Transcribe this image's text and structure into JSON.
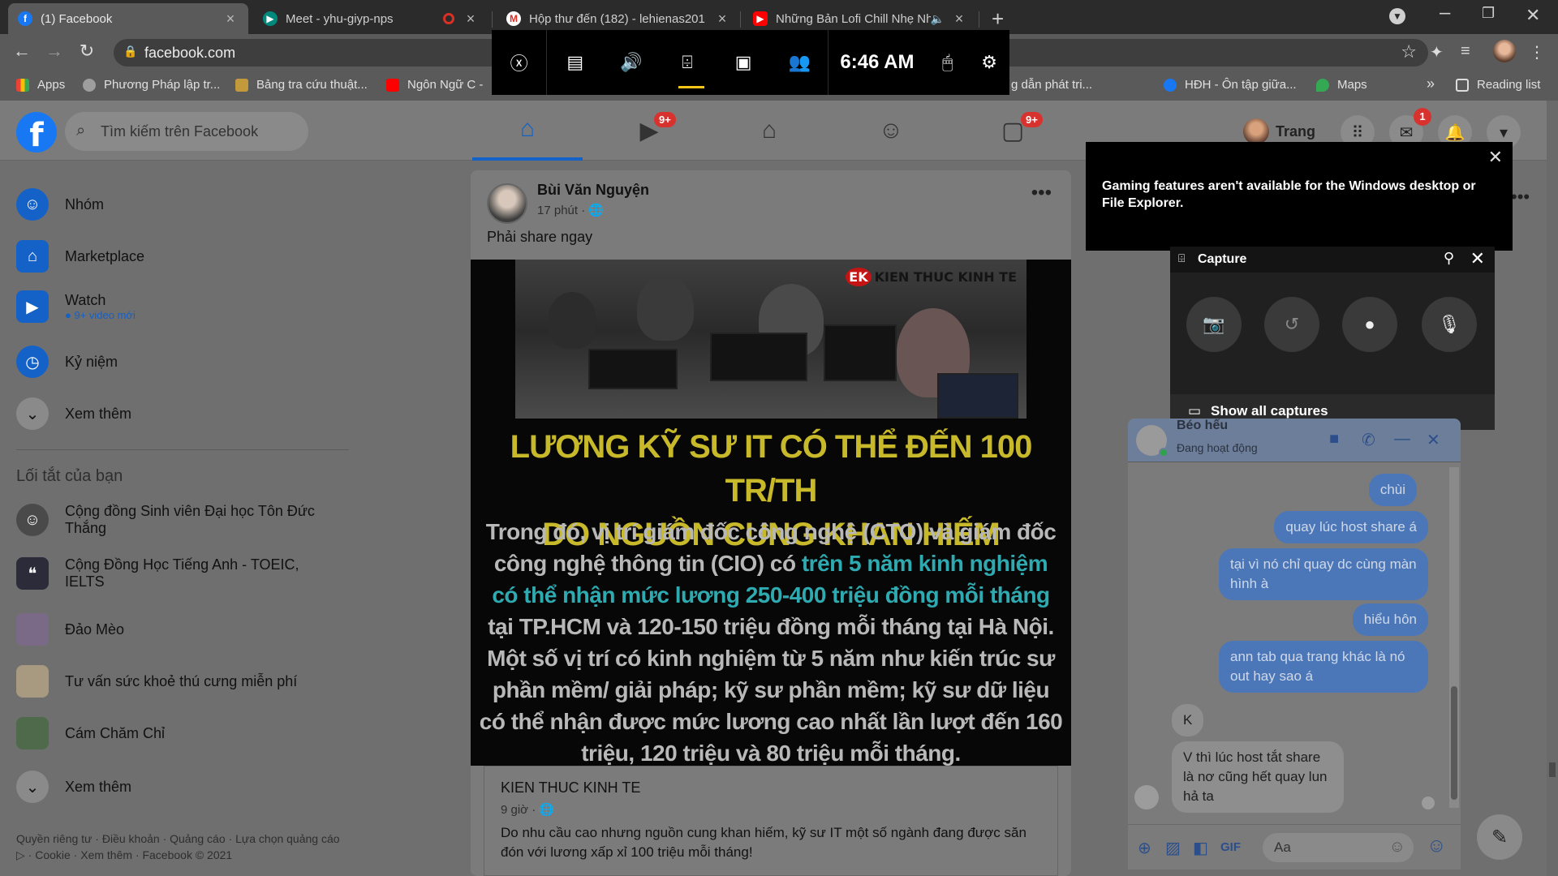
{
  "browser": {
    "tabs": [
      {
        "title": "(1) Facebook",
        "favicon": "facebook-icon",
        "color": "#1877f2",
        "active": true
      },
      {
        "title": "Meet - yhu-giyp-nps",
        "favicon": "google-meet-icon",
        "color": "#00897b",
        "active": false
      },
      {
        "title": "Hộp thư đến (182) - lehienas201",
        "favicon": "gmail-icon",
        "color": "#d93025",
        "active": false
      },
      {
        "title": "Những Bản Lofi Chill Nhẹ Nh",
        "favicon": "youtube-icon",
        "color": "#ff0000",
        "active": false
      }
    ],
    "url": "facebook.com",
    "bookmarks": [
      {
        "label": "Apps",
        "icon": "apps-grid-icon",
        "color": "#e0e0e0"
      },
      {
        "label": "Phương Pháp lập tr...",
        "icon": "globe-icon",
        "color": "#9e9e9e"
      },
      {
        "label": "Bảng tra cứu thuật...",
        "icon": "mathworks-icon",
        "color": "#c29a3b"
      },
      {
        "label": "Ngôn Ngữ C -",
        "icon": "youtube-icon",
        "color": "#ff0000"
      },
      {
        "label": "g dẫn phát tri...",
        "icon": "",
        "color": ""
      },
      {
        "label": "HĐH - Ôn tập giữa...",
        "icon": "facebook-icon",
        "color": "#1877f2"
      },
      {
        "label": "Maps",
        "icon": "maps-pin-icon",
        "color": "#34a853"
      }
    ],
    "bookmarks_overflow": "»",
    "reading_list": "Reading list"
  },
  "facebook": {
    "search_placeholder": "Tìm kiếm trên Facebook",
    "nav_badges": {
      "watch": "9+",
      "gaming": "9+"
    },
    "user_name": "Trang",
    "messenger_badge": "1",
    "left_nav": [
      {
        "label": "Nhóm",
        "icon": "groups-icon",
        "color": "#1461c7"
      },
      {
        "label": "Marketplace",
        "icon": "marketplace-icon",
        "color": "#1461c7"
      },
      {
        "label": "Watch",
        "sub": "9+ video mới",
        "icon": "watch-icon",
        "color": "#1461c7"
      },
      {
        "label": "Kỷ niệm",
        "icon": "memories-icon",
        "color": "#1461c7"
      },
      {
        "label": "Xem thêm",
        "icon": "chevron-down-icon",
        "color": "#8a8a8a"
      }
    ],
    "shortcuts_heading": "Lối tắt của bạn",
    "shortcuts": [
      {
        "label": "Cộng đồng Sinh viên Đại học Tôn Đức Thắng"
      },
      {
        "label": "Cộng Đồng Học Tiếng Anh - TOEIC, IELTS"
      },
      {
        "label": "Đảo Mèo"
      },
      {
        "label": "Tư vấn sức khoẻ thú cưng miễn phí"
      },
      {
        "label": "Cám Chăm Chỉ"
      },
      {
        "label": "Xem thêm"
      }
    ],
    "footer": "Quyền riêng tư · Điều khoản · Quảng cáo · Lựa chọn quảng cáo ▷ · Cookie · Xem thêm · Facebook © 2021"
  },
  "post": {
    "author": "Bùi Văn Nguyện",
    "time": "17 phút",
    "text": "Phải share ngay",
    "image_logo": "KIEN THUC KINH TE",
    "image_logo_mark": "EK",
    "image_headline_1": "LƯƠNG KỸ SƯ IT CÓ THỂ ĐẾN 100 TR/TH",
    "image_headline_2": "DO NGUỒN CUNG KHAN HIẾM",
    "image_body_1": "Trong đó, vị trí giám đốc công nghệ (CTO) và giám đốc",
    "image_body_2a": "công nghệ thông tin (CIO) có ",
    "image_body_2b": "trên 5 năm kinh nghiệm",
    "image_body_3": "có thể nhận mức lương 250-400 triệu đồng mỗi tháng",
    "image_body_4": "tại TP.HCM và 120-150 triệu đồng mỗi tháng tại Hà Nội.",
    "image_body_5": "Một số vị trí có kinh nghiệm từ 5 năm như kiến trúc sư",
    "image_body_6": "phần mềm/ giải pháp; kỹ sư phần mềm; kỹ sư dữ liệu",
    "image_body_7": "có thể nhận được mức lương cao nhất lần lượt đến 160",
    "image_body_8": "triệu, 120 triệu và 80 triệu mỗi tháng.",
    "link_source": "KIEN THUC KINH TE",
    "link_time": "9 giờ",
    "link_desc": "Do nhu cầu cao nhưng nguồn cung khan hiếm, kỹ sư IT một số ngành đang được săn đón với lương xấp xỉ 100 triệu mỗi tháng!"
  },
  "gamebar": {
    "time": "6:46 AM",
    "toast": "Gaming features aren't available for the Windows desktop or File Explorer.",
    "capture_title": "Capture",
    "show_all": "Show all captures"
  },
  "chat": {
    "name": "Béo hếu",
    "status": "Đang hoạt động",
    "messages": [
      {
        "from": "me",
        "text": "chùi"
      },
      {
        "from": "me",
        "text": "quay lúc host share á"
      },
      {
        "from": "me",
        "text": "tại vì nó chỉ quay dc cùng màn hình à"
      },
      {
        "from": "me",
        "text": "hiểu hôn"
      },
      {
        "from": "me",
        "text": "ann tab qua trang khác là nó out hay sao á"
      },
      {
        "from": "them",
        "text": "K"
      },
      {
        "from": "them",
        "text": "V thì lúc host tắt share là nơ cũng hết quay lun hả ta"
      }
    ],
    "input_placeholder": "Aa"
  }
}
